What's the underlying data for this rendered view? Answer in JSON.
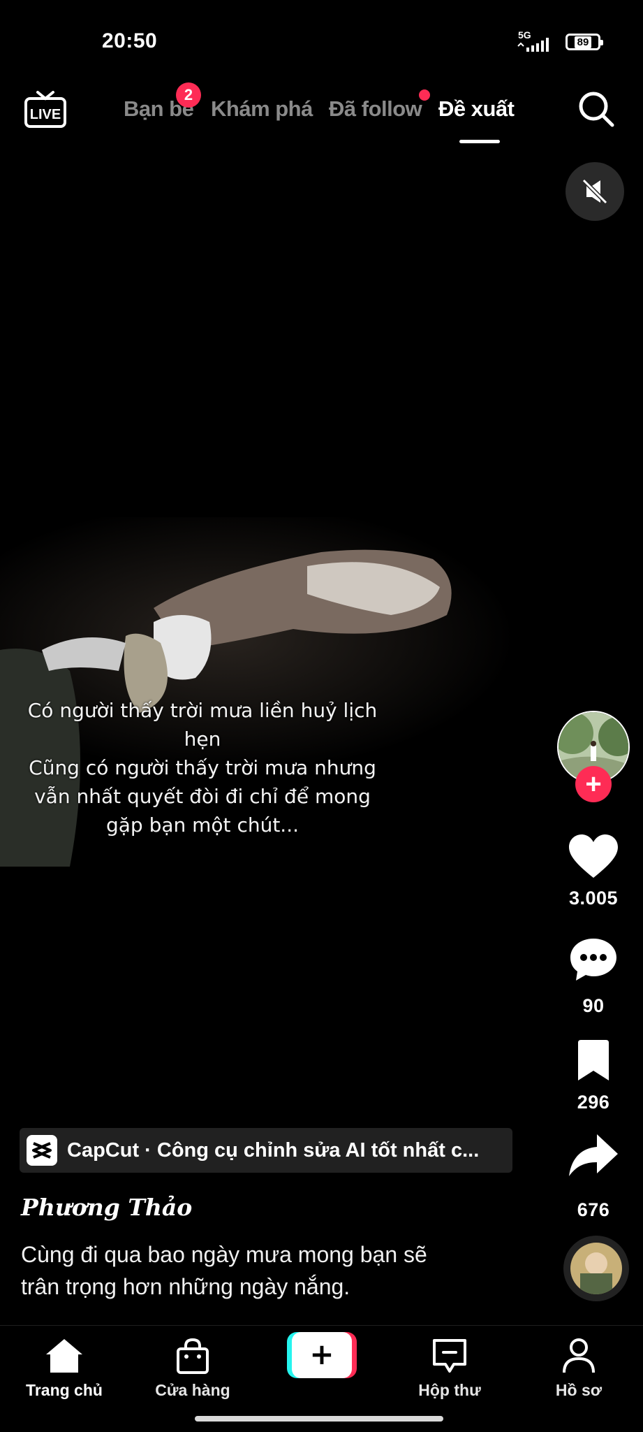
{
  "status_bar": {
    "time": "20:50",
    "network": "5G",
    "battery": "89"
  },
  "top_nav": {
    "live_label": "LIVE",
    "tabs": [
      {
        "label": "Bạn bè",
        "badge": "2"
      },
      {
        "label": "Khám phá"
      },
      {
        "label": "Đã follow",
        "dot": true
      },
      {
        "label": "Đề xuất",
        "active": true
      }
    ]
  },
  "video": {
    "caption_lines": [
      "Có người thấy trời mưa liền huỷ lịch",
      "hẹn",
      "Cũng có người thấy trời mưa nhưng",
      "vẫn nhất quyết đòi đi chỉ để mong",
      "gặp bạn một chút..."
    ]
  },
  "actions": {
    "likes": "3.005",
    "comments": "90",
    "bookmarks": "296",
    "shares": "676"
  },
  "anchor": {
    "text": "CapCut · Công cụ chỉnh sửa AI tốt nhất c..."
  },
  "post": {
    "username": "Phương Thảo",
    "description_lines": [
      "Cùng đi qua bao ngày mưa mong bạn sẽ",
      "trân trọng hơn những ngày nắng."
    ]
  },
  "bottom_nav": {
    "home": "Trang chủ",
    "shop": "Cửa hàng",
    "create": "+",
    "inbox": "Hộp thư",
    "profile": "Hồ sơ"
  },
  "colors": {
    "accent": "#fe2c55",
    "tab_inactive": "#8a8a8a",
    "cyan": "#25f4ee"
  }
}
